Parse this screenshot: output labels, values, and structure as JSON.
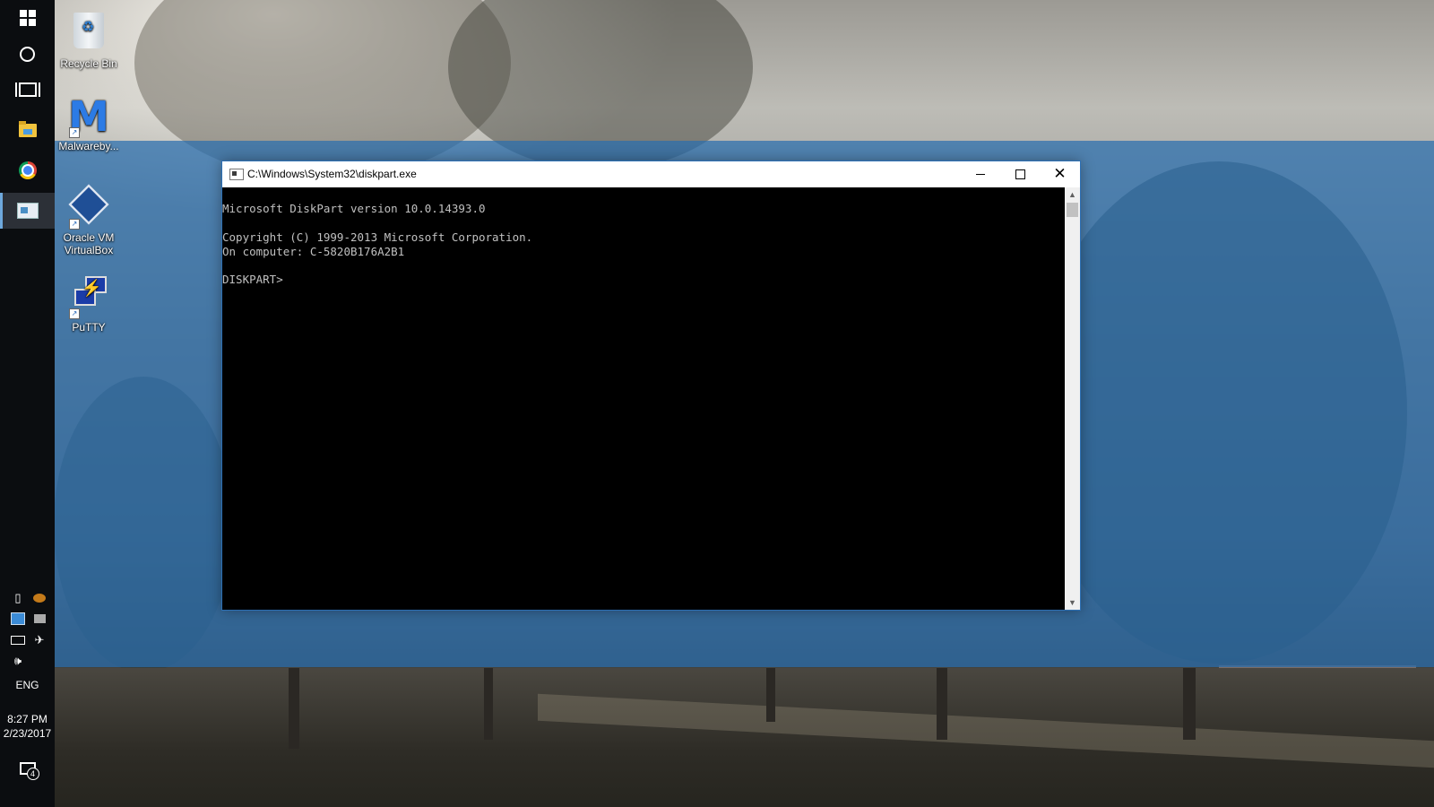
{
  "desktop": {
    "icons": [
      {
        "label": "Recycle Bin",
        "icon": "recycle-bin-icon"
      },
      {
        "label": "Malwareby...",
        "icon": "malwarebytes-icon"
      },
      {
        "label": "Oracle VM VirtualBox",
        "icon": "virtualbox-icon"
      },
      {
        "label": "PuTTY",
        "icon": "putty-icon"
      }
    ]
  },
  "taskbar": {
    "buttons": [
      {
        "name": "start",
        "icon": "windows-logo-icon"
      },
      {
        "name": "cortana",
        "icon": "cortana-circle-icon"
      },
      {
        "name": "task-view",
        "icon": "task-view-icon"
      },
      {
        "name": "file-explorer",
        "icon": "folder-icon"
      },
      {
        "name": "chrome",
        "icon": "chrome-icon"
      },
      {
        "name": "diskpart",
        "icon": "console-window-icon",
        "active": true
      }
    ],
    "tray": {
      "language": "ENG",
      "time": "8:27 PM",
      "date": "2/23/2017",
      "notification_count": "4"
    }
  },
  "window": {
    "title": "C:\\Windows\\System32\\diskpart.exe",
    "console_lines": [
      "Microsoft DiskPart version 10.0.14393.0",
      "",
      "Copyright (C) 1999-2013 Microsoft Corporation.",
      "On computer: C-5820B176A2B1",
      "",
      "DISKPART>"
    ]
  },
  "colors": {
    "taskbar_bg": "#0b0d10",
    "accent": "#2d6fb3",
    "console_bg": "#000000",
    "console_text": "#c0c0c0"
  }
}
